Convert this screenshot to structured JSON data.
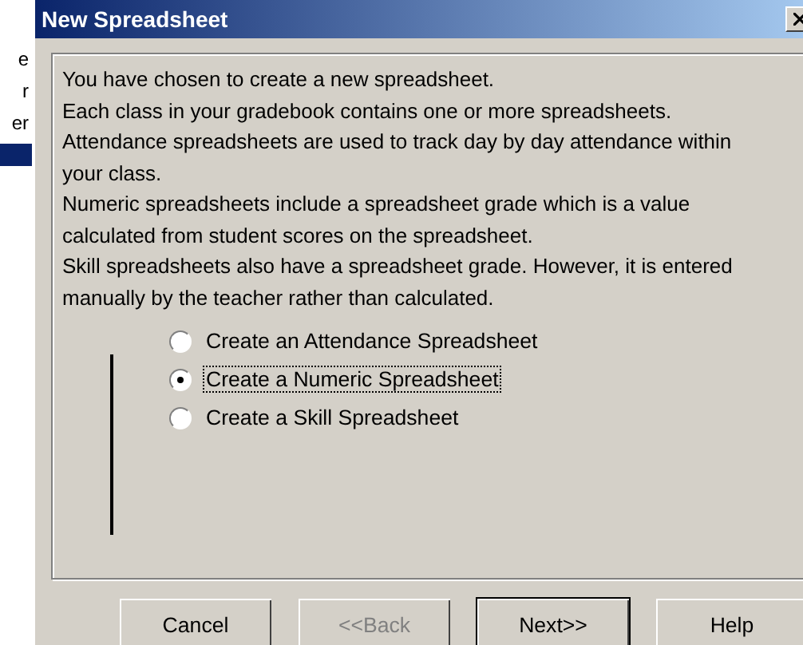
{
  "background": {
    "fragments": [
      {
        "text": "e",
        "selected": false
      },
      {
        "text": "r",
        "selected": false
      },
      {
        "text": "er",
        "selected": false
      },
      {
        "selected": true
      }
    ]
  },
  "window": {
    "title": "New Spreadsheet"
  },
  "paragraphs": [
    "You have chosen to create a new spreadsheet.",
    "Each class in your gradebook contains one or more spreadsheets.",
    "Attendance spreadsheets are used to track day by day attendance within your class.",
    "Numeric spreadsheets include a spreadsheet grade which is a value calculated from student scores on the spreadsheet.",
    "Skill spreadsheets also have a spreadsheet grade. However, it is entered manually by the teacher rather than calculated."
  ],
  "options": [
    {
      "label": "Create an Attendance Spreadsheet",
      "selected": false
    },
    {
      "label": "Create a Numeric Spreadsheet",
      "selected": true
    },
    {
      "label": "Create a Skill Spreadsheet",
      "selected": false
    }
  ],
  "buttons": [
    {
      "label": "Cancel",
      "disabled": false,
      "default": false
    },
    {
      "label": "<<Back",
      "disabled": true,
      "default": false
    },
    {
      "label": "Next>>",
      "disabled": false,
      "default": true
    },
    {
      "label": "Help",
      "disabled": false,
      "default": false
    }
  ]
}
